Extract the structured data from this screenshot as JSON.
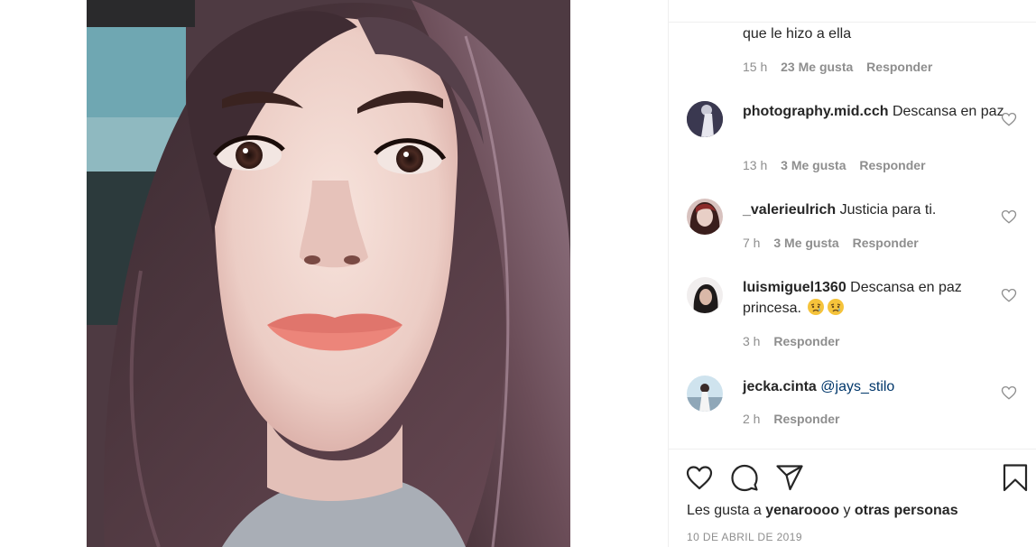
{
  "post": {
    "image_alt": "Selfie of a young woman with long dark hair"
  },
  "comments": [
    {
      "text": "que le hizo a ella",
      "time": "15 h",
      "likes": "23 Me gusta",
      "reply": "Responder"
    },
    {
      "username": "photography.mid.cch",
      "text": "Descansa en paz",
      "time": "13 h",
      "likes": "3 Me gusta",
      "reply": "Responder"
    },
    {
      "username": "_valerieulrich",
      "text": "Justicia para ti.",
      "time": "7 h",
      "likes": "3 Me gusta",
      "reply": "Responder"
    },
    {
      "username": "luismiguel1360",
      "text": "Descansa en paz princesa.",
      "emoji": [
        "crying-face",
        "crying-face"
      ],
      "time": "3 h",
      "reply": "Responder"
    },
    {
      "username": "jecka.cinta",
      "mention": "@jays_stilo",
      "time": "2 h",
      "reply": "Responder"
    }
  ],
  "actions": {
    "icons": [
      "heart-icon",
      "comment-icon",
      "share-icon",
      "bookmark-icon"
    ]
  },
  "likes_line": {
    "prefix": "Les gusta a",
    "user": "yenaroooo",
    "connector": "y",
    "others": "otras personas"
  },
  "date": "10 DE ABRIL DE 2019",
  "colors": {
    "text": "#262626",
    "secondary": "#8e8e8e",
    "mention": "#00376b",
    "divider": "#efefef"
  }
}
